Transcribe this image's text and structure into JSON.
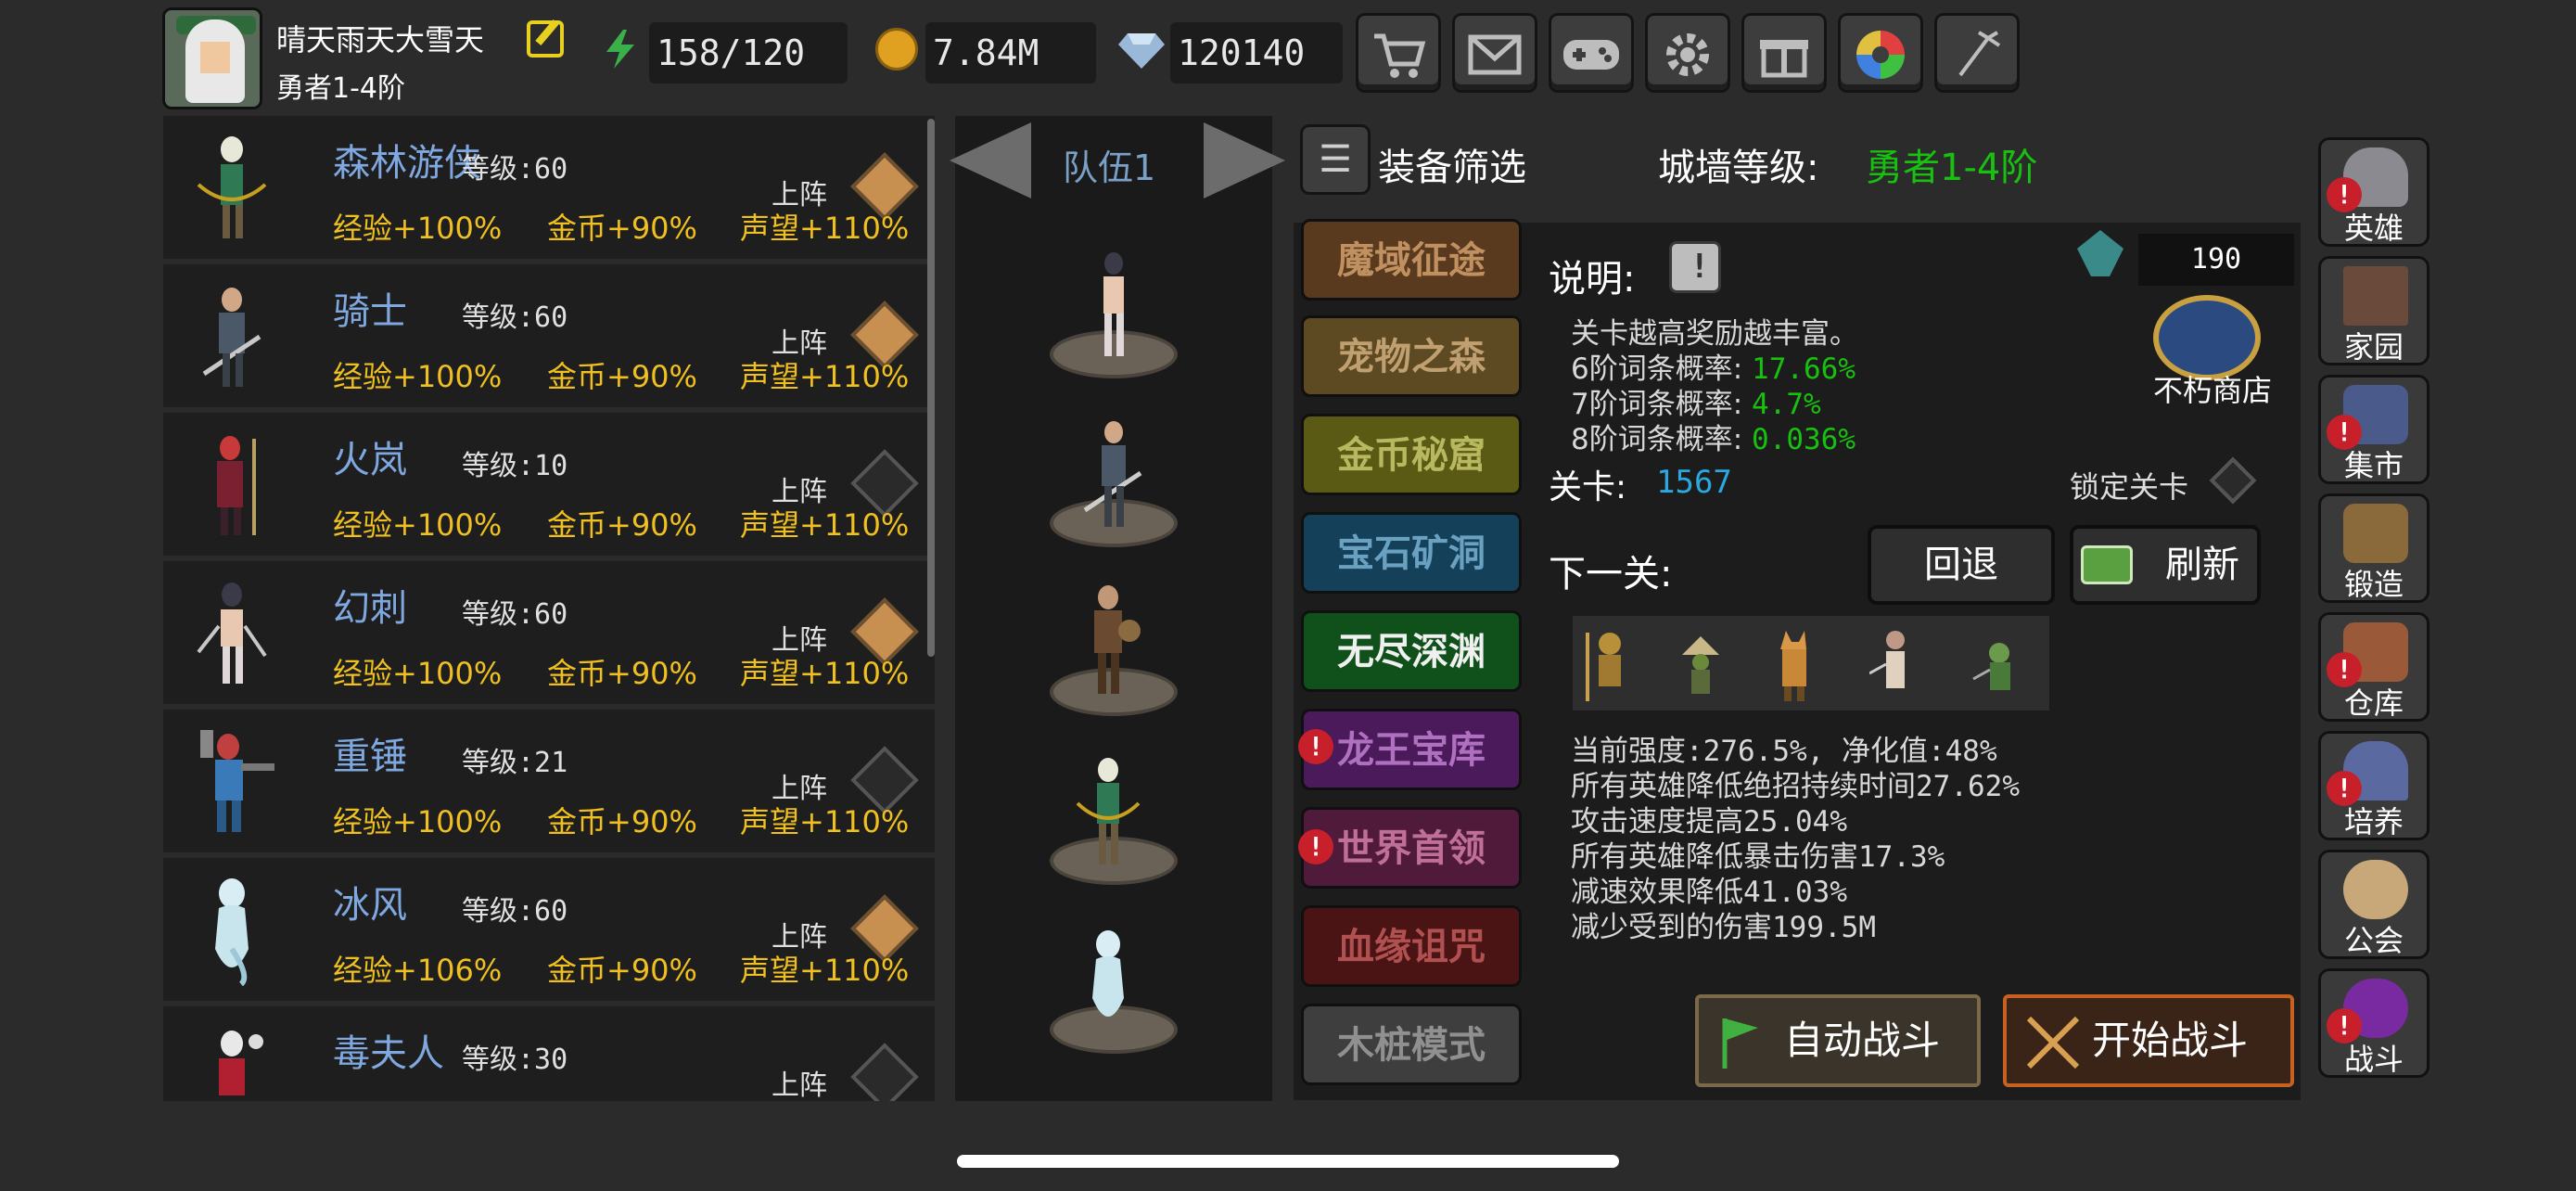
{
  "player": {
    "name": "晴天雨天大雪天",
    "rank": "勇者1-4阶"
  },
  "resources": {
    "energy": "158/120",
    "gold": "7.84M",
    "gems": "120140"
  },
  "top_icons": [
    "cart-icon",
    "mail-icon",
    "gamepad-icon",
    "gear-icon",
    "gift-icon",
    "color-wheel-icon",
    "firework-icon"
  ],
  "heroes": [
    {
      "name": "森林游侠",
      "level": "等级:60",
      "deploy": "上阵",
      "exp": "经验+100%",
      "gold": "金币+90%",
      "fame": "声望+110%",
      "active": true
    },
    {
      "name": "骑士",
      "level": "等级:60",
      "deploy": "上阵",
      "exp": "经验+100%",
      "gold": "金币+90%",
      "fame": "声望+110%",
      "active": true
    },
    {
      "name": "火岚",
      "level": "等级:10",
      "deploy": "上阵",
      "exp": "经验+100%",
      "gold": "金币+90%",
      "fame": "声望+110%",
      "active": false
    },
    {
      "name": "幻刺",
      "level": "等级:60",
      "deploy": "上阵",
      "exp": "经验+100%",
      "gold": "金币+90%",
      "fame": "声望+110%",
      "active": true
    },
    {
      "name": "重锤",
      "level": "等级:21",
      "deploy": "上阵",
      "exp": "经验+100%",
      "gold": "金币+90%",
      "fame": "声望+110%",
      "active": false
    },
    {
      "name": "冰风",
      "level": "等级:60",
      "deploy": "上阵",
      "exp": "经验+106%",
      "gold": "金币+90%",
      "fame": "声望+110%",
      "active": true
    },
    {
      "name": "毒夫人",
      "level": "等级:30",
      "deploy": "上阵",
      "exp": "",
      "gold": "",
      "fame": "",
      "active": false
    }
  ],
  "team": {
    "title": "队伍1"
  },
  "filter": {
    "label": "装备筛选",
    "wall_label": "城墙等级:",
    "wall_value": "勇者1-4阶"
  },
  "modes": [
    "魔域征途",
    "宠物之森",
    "金币秘窟",
    "宝石矿洞",
    "无尽深渊",
    "龙王宝库",
    "世界首领",
    "血缘诅咒",
    "木桩模式"
  ],
  "description": {
    "label": "说明:",
    "gem_count": "190",
    "shop_label": "不朽商店",
    "text": "关卡越高奖励越丰富。",
    "rates": [
      {
        "label": "6阶词条概率:",
        "value": "17.66%"
      },
      {
        "label": "7阶词条概率:",
        "value": "4.7%"
      },
      {
        "label": "8阶词条概率:",
        "value": "0.036%"
      }
    ]
  },
  "stage": {
    "label": "关卡:",
    "value": "1567",
    "lock_label": "锁定关卡"
  },
  "next": {
    "label": "下一关:",
    "retreat": "回退",
    "refresh": "刷新"
  },
  "modifiers": [
    "当前强度:276.5%, 净化值:48%",
    "所有英雄降低绝招持续时间27.62%",
    "攻击速度提高25.04%",
    "所有英雄降低暴击伤害17.3%",
    "减速效果降低41.03%",
    "减少受到的伤害199.5M"
  ],
  "battle": {
    "auto": "自动战斗",
    "start": "开始战斗"
  },
  "side_menu": [
    "英雄",
    "家园",
    "集市",
    "锻造",
    "仓库",
    "培养",
    "公会",
    "战斗"
  ],
  "colors": {
    "gold_text": "#f0c020",
    "green_text": "#18c010",
    "hero_name": "#7fa8e0",
    "stage_blue": "#2aa8e0"
  }
}
